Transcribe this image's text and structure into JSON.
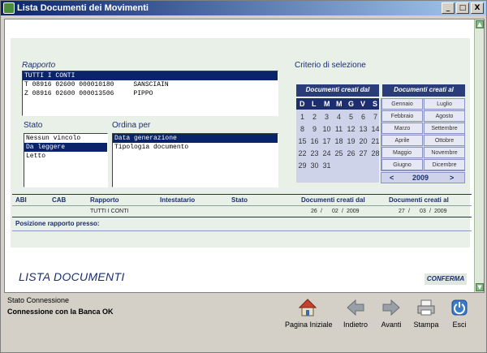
{
  "window": {
    "title": "Lista Documenti dei Movimenti",
    "controls": {
      "minimize": "_",
      "maximize": "□",
      "close": "X"
    }
  },
  "rapporto": {
    "label": "Rapporto",
    "items": [
      {
        "text": "TUTTI I CONTI",
        "selected": true
      },
      {
        "text": "T 08916 02600 000010180     SANSCIAIN",
        "selected": false
      },
      {
        "text": "Z 08916 02600 000013506     PIPPO",
        "selected": false
      }
    ]
  },
  "criterio": {
    "label": "Criterio di selezione",
    "header_dal": "Documenti creati dal",
    "header_al": "Documenti creati al",
    "weekdays": [
      "D",
      "L",
      "M",
      "M",
      "G",
      "V",
      "S"
    ],
    "days": [
      "1",
      "2",
      "3",
      "4",
      "5",
      "6",
      "7",
      "8",
      "9",
      "10",
      "11",
      "12",
      "13",
      "14",
      "15",
      "16",
      "17",
      "18",
      "19",
      "20",
      "21",
      "22",
      "23",
      "24",
      "25",
      "26",
      "27",
      "28",
      "29",
      "30",
      "31"
    ],
    "months": [
      "Gennaio",
      "Luglio",
      "Febbraio",
      "Agosto",
      "Marzo",
      "Settembre",
      "Aprile",
      "Ottobre",
      "Maggio",
      "Novembre",
      "Giugno",
      "Dicembre"
    ],
    "year": "2009",
    "prev": "<",
    "next": ">"
  },
  "stato": {
    "label": "Stato",
    "items": [
      {
        "text": "Nessun vincolo",
        "selected": false
      },
      {
        "text": "Da leggere",
        "selected": true
      },
      {
        "text": "Letto",
        "selected": false
      }
    ]
  },
  "ordina": {
    "label": "Ordina per",
    "items": [
      {
        "text": "Data generazione",
        "selected": true
      },
      {
        "text": "Tipologia documento",
        "selected": false
      }
    ]
  },
  "table": {
    "headers": {
      "abi": "ABI",
      "cab": "CAB",
      "rapporto": "Rapporto",
      "intestatario": "Intestatario",
      "stato": "Stato",
      "dal": "Documenti creati dal",
      "al": "Documenti creati al"
    },
    "row": {
      "rapporto": "TUTTI I CONTI",
      "dal_day": "26",
      "dal_month": "02",
      "dal_year": "2009",
      "al_day": "27",
      "al_month": "03",
      "al_year": "2009",
      "sep": "/"
    },
    "posizione": "Posizione rapporto presso:"
  },
  "footer": {
    "title": "LISTA DOCUMENTI",
    "confirm": "CONFERMA"
  },
  "status": {
    "title": "Stato Connessione",
    "text": "Connessione con la Banca OK"
  },
  "nav": {
    "home": "Pagina Iniziale",
    "back": "Indietro",
    "forward": "Avanti",
    "print": "Stampa",
    "exit": "Esci"
  }
}
